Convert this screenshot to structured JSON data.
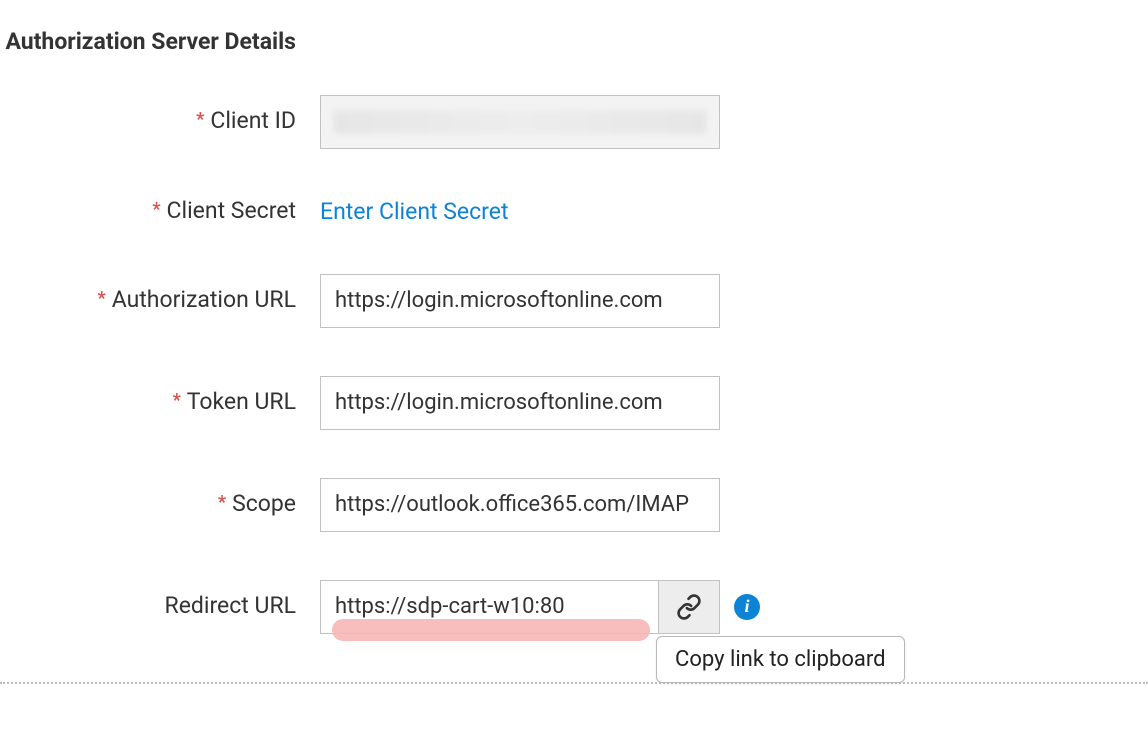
{
  "section": {
    "heading": "Authorization Server Details"
  },
  "fields": {
    "client_id": {
      "label": "Client ID",
      "required": true,
      "value": ""
    },
    "client_secret": {
      "label": "Client Secret",
      "required": true,
      "action_text": "Enter Client Secret"
    },
    "authorization_url": {
      "label": "Authorization URL",
      "required": true,
      "value": "https://login.microsoftonline.com"
    },
    "token_url": {
      "label": "Token URL",
      "required": true,
      "value": "https://login.microsoftonline.com"
    },
    "scope": {
      "label": "Scope",
      "required": true,
      "value": "https://outlook.office365.com/IMAP"
    },
    "redirect_url": {
      "label": "Redirect URL",
      "required": false,
      "value": "https://sdp-cart-w10:80",
      "tooltip": "Copy link to clipboard"
    }
  },
  "icons": {
    "link": "link-icon",
    "info": "i"
  }
}
